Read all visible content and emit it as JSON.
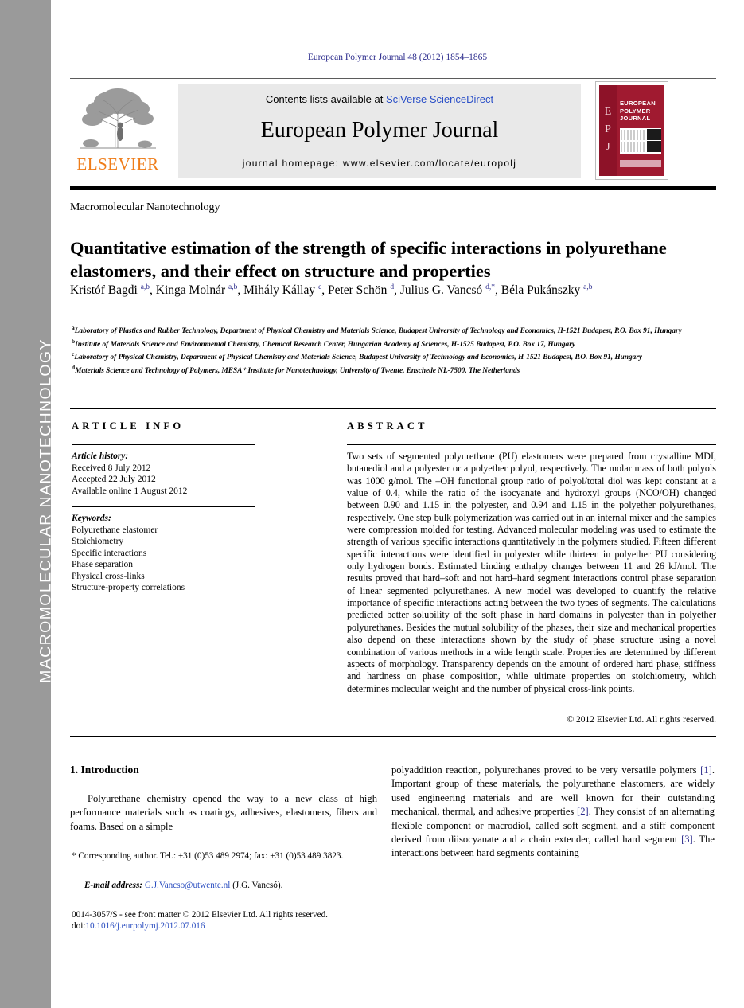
{
  "sidebar": {
    "label": "MACROMOLECULAR NANOTECHNOLOGY",
    "color": "#9a9a9a"
  },
  "header": {
    "journal_reference": "European Polymer Journal 48 (2012) 1854–1865",
    "contents_prefix": "Contents lists available at ",
    "contents_link": "SciVerse ScienceDirect",
    "journal_title": "European Polymer Journal",
    "homepage": "journal homepage: www.elsevier.com/locate/europolj",
    "publisher_name": "ELSEVIER",
    "publisher_color": "#ef7d1a",
    "cover": {
      "letters": [
        "E",
        "P",
        "J"
      ],
      "title_lines": [
        "EUROPEAN",
        "POLYMER",
        "JOURNAL"
      ],
      "color": "#a01a30"
    }
  },
  "article": {
    "section_label": "Macromolecular Nanotechnology",
    "title": "Quantitative estimation of the strength of specific interactions in polyurethane elastomers, and their effect on structure and properties",
    "authors": [
      {
        "name": "Kristóf Bagdi",
        "sup": "a,b",
        "sep": ", "
      },
      {
        "name": "Kinga Molnár",
        "sup": "a,b",
        "sep": ", "
      },
      {
        "name": "Mihály Kállay",
        "sup": "c",
        "sep": ", "
      },
      {
        "name": "Peter Schön",
        "sup": "d",
        "sep": ", "
      },
      {
        "name": "Julius G. Vancsó",
        "sup": "d,*",
        "sep": ", "
      },
      {
        "name": "Béla Pukánszky",
        "sup": "a,b",
        "sep": ""
      }
    ],
    "affiliations": [
      {
        "marker": "a",
        "text": "Laboratory of Plastics and Rubber Technology, Department of Physical Chemistry and Materials Science, Budapest University of Technology and Economics, H-1521 Budapest, P.O. Box 91, Hungary"
      },
      {
        "marker": "b",
        "text": "Institute of Materials Science and Environmental Chemistry, Chemical Research Center, Hungarian Academy of Sciences, H-1525 Budapest, P.O. Box 17, Hungary"
      },
      {
        "marker": "c",
        "text": "Laboratory of Physical Chemistry, Department of Physical Chemistry and Materials Science, Budapest University of Technology and Economics, H-1521 Budapest, P.O. Box 91, Hungary"
      },
      {
        "marker": "d",
        "text": "Materials Science and Technology of Polymers, MESA⁺ Institute for Nanotechnology, University of Twente, Enschede NL-7500, The Netherlands"
      }
    ]
  },
  "info": {
    "heading": "ARTICLE INFO",
    "history_title": "Article history:",
    "history": [
      "Received 8 July 2012",
      "Accepted 22 July 2012",
      "Available online 1 August 2012"
    ],
    "keywords_title": "Keywords:",
    "keywords": [
      "Polyurethane elastomer",
      "Stoichiometry",
      "Specific interactions",
      "Phase separation",
      "Physical cross-links",
      "Structure-property correlations"
    ]
  },
  "abstract": {
    "heading": "ABSTRACT",
    "text": "Two sets of segmented polyurethane (PU) elastomers were prepared from crystalline MDI, butanediol and a polyester or a polyether polyol, respectively. The molar mass of both polyols was 1000 g/mol. The –OH functional group ratio of polyol/total diol was kept constant at a value of 0.4, while the ratio of the isocyanate and hydroxyl groups (NCO/OH) changed between 0.90 and 1.15 in the polyester, and 0.94 and 1.15 in the polyether polyurethanes, respectively. One step bulk polymerization was carried out in an internal mixer and the samples were compression molded for testing. Advanced molecular modeling was used to estimate the strength of various specific interactions quantitatively in the polymers studied. Fifteen different specific interactions were identified in polyester while thirteen in polyether PU considering only hydrogen bonds. Estimated binding enthalpy changes between 11 and 26 kJ/mol. The results proved that hard–soft and not hard–hard segment interactions control phase separation of linear segmented polyurethanes. A new model was developed to quantify the relative importance of specific interactions acting between the two types of segments. The calculations predicted better solubility of the soft phase in hard domains in polyester than in polyether polyurethanes. Besides the mutual solubility of the phases, their size and mechanical properties also depend on these interactions shown by the study of phase structure using a novel combination of various methods in a wide length scale. Properties are determined by different aspects of morphology. Transparency depends on the amount of ordered hard phase, stiffness and hardness on phase composition, while ultimate properties on stoichiometry, which determines molecular weight and the number of physical cross-link points.",
    "copyright": "© 2012 Elsevier Ltd. All rights reserved."
  },
  "body": {
    "intro_heading": "1. Introduction",
    "left_paragraph": "Polyurethane chemistry opened the way to a new class of high performance materials such as coatings, adhesives, elastomers, fibers and foams. Based on a simple",
    "right_paragraph_part1": "polyaddition reaction, polyurethanes proved to be very versatile polymers ",
    "ref1": "[1]",
    "right_paragraph_part2": ". Important group of these materials, the polyurethane elastomers, are widely used engineering materials and are well known for their outstanding mechanical, thermal, and adhesive properties ",
    "ref2": "[2]",
    "right_paragraph_part3": ". They consist of an alternating flexible component or macrodiol, called soft segment, and a stiff component derived from diisocyanate and a chain extender, called hard segment ",
    "ref3": "[3]",
    "right_paragraph_part4": ". The interactions between hard segments containing"
  },
  "footer": {
    "corresponding_author": "* Corresponding author. Tel.: +31 (0)53 489 2974; fax: +31 (0)53 489 3823.",
    "email_label": "E-mail address:",
    "email": "G.J.Vancso@utwente.nl",
    "email_suffix": "(J.G. Vancsó).",
    "issn_line": "0014-3057/$ - see front matter © 2012 Elsevier Ltd. All rights reserved.",
    "doi_label": "doi:",
    "doi": "10.1016/j.eurpolymj.2012.07.016"
  }
}
